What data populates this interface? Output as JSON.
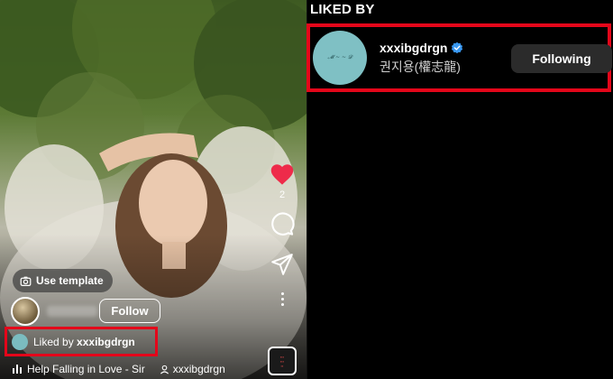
{
  "reel": {
    "use_template_label": "Use template",
    "follow_label": "Follow",
    "liked_by_prefix": "Liked by",
    "liked_by_user": "xxxibgdrgn",
    "like_count": "2",
    "music_title": "Help Falling in Love - Sir",
    "music_user": "xxxibgdrgn",
    "icons": [
      "camera-template-icon",
      "heart-icon",
      "comment-icon",
      "send-icon",
      "more-vertical-icon",
      "audio-bars-icon",
      "user-icon"
    ]
  },
  "liked_panel": {
    "title": "LIKED BY",
    "user": {
      "handle": "xxxibgdrgn",
      "full_name": "권지용(權志龍)",
      "verified": true,
      "button_label": "Following"
    }
  },
  "colors": {
    "highlight": "#e4061a",
    "like_heart": "#ee2b4a",
    "verified": "#3897f0",
    "following_bg": "#2b2b2b"
  }
}
